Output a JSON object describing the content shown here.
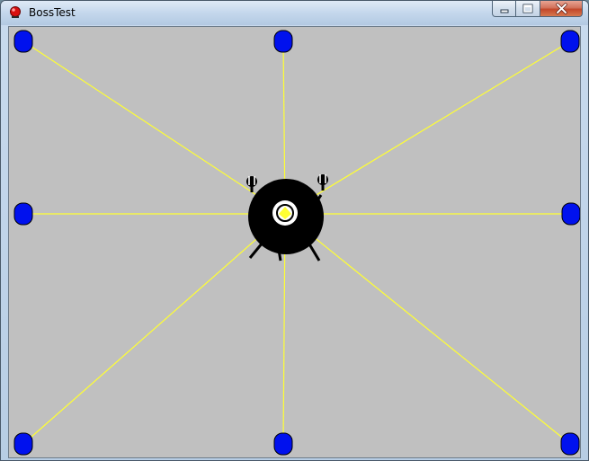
{
  "window": {
    "title": "BossTest",
    "app_icon": "red-ball-icon",
    "buttons": {
      "minimize": "minimize-icon",
      "maximize": "maximize-icon",
      "close": "close-icon"
    }
  },
  "game": {
    "background_color": "#c0c0c0",
    "beam_color": "#ffff33",
    "node_color": "#0011ee",
    "boss_color": "#000000",
    "nodes": [
      {
        "id": "top-left"
      },
      {
        "id": "top-center"
      },
      {
        "id": "top-right"
      },
      {
        "id": "middle-left"
      },
      {
        "id": "middle-right"
      },
      {
        "id": "bottom-left"
      },
      {
        "id": "bottom-center"
      },
      {
        "id": "bottom-right"
      }
    ]
  }
}
